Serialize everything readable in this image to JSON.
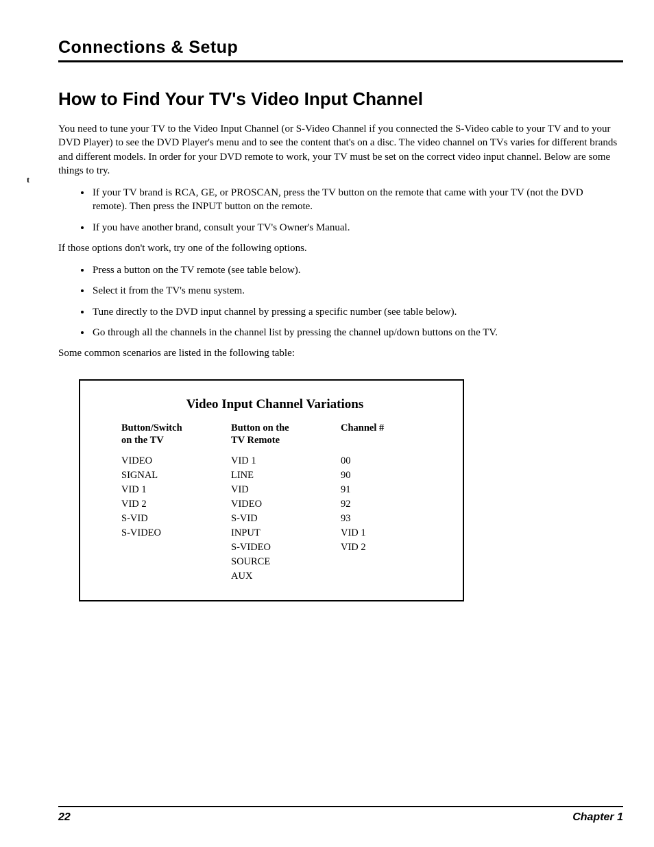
{
  "header": {
    "title": "Connections & Setup"
  },
  "section": {
    "heading": "How to Find Your TV's Video Input Channel",
    "intro": "You need to tune your TV to the Video Input Channel (or S-Video Channel if you connected the S-Video cable to your TV and to your DVD Player) to see the DVD Player's menu and to see the content that's on a disc. The video channel on TVs varies for different brands and different models. In order for your DVD remote to work, your TV must be set on the correct video input channel. Below are some things to try.",
    "bullets1": [
      "If your TV brand is RCA, GE, or PROSCAN, press the TV button on the remote that came with your TV (not the DVD remote). Then press the INPUT button on the remote.",
      "If you have another brand, consult your TV's Owner's Manual."
    ],
    "mid": "If those options don't work, try one of the following options.",
    "bullets2": [
      "Press a button on the TV remote (see table below).",
      "Select it from the TV's menu system.",
      "Tune directly to the DVD input channel by pressing a specific number (see table below).",
      "Go through all the channels in the channel list by pressing the channel up/down buttons on the TV."
    ],
    "outro": "Some common scenarios are listed in the following table:"
  },
  "table": {
    "title": "Video Input Channel Variations",
    "headers": {
      "col1a": "Button/Switch",
      "col1b": "on the TV",
      "col2a": "Button on the",
      "col2b": "TV Remote",
      "col3": "Channel #"
    },
    "col1": [
      "VIDEO",
      "SIGNAL",
      "VID 1",
      "VID 2",
      "S-VID",
      "S-VIDEO"
    ],
    "col2": [
      "VID 1",
      "LINE",
      "VID",
      "VIDEO",
      "S-VID",
      "INPUT",
      "S-VIDEO",
      "SOURCE",
      "AUX"
    ],
    "col3": [
      "00",
      "90",
      "91",
      "92",
      "93",
      "VID 1",
      "VID 2"
    ]
  },
  "footer": {
    "page": "22",
    "chapter": "Chapter 1"
  }
}
